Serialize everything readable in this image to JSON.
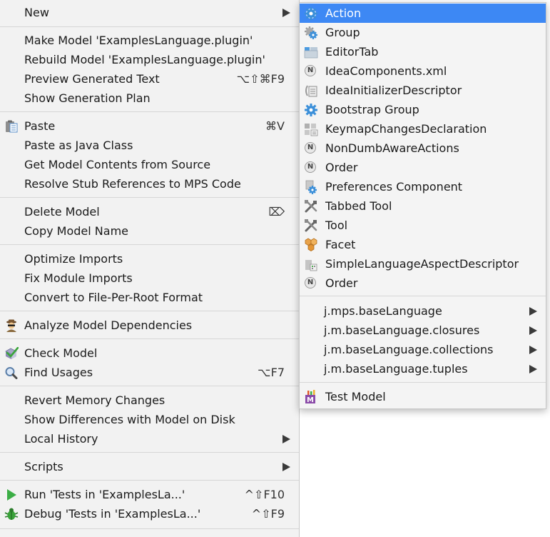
{
  "main_menu": {
    "new": {
      "label": "New"
    },
    "make_model": {
      "label": "Make Model 'ExamplesLanguage.plugin'"
    },
    "rebuild_model": {
      "label": "Rebuild Model 'ExamplesLanguage.plugin'"
    },
    "preview_text": {
      "label": "Preview Generated Text",
      "shortcut": "⌥⇧⌘F9"
    },
    "show_plan": {
      "label": "Show Generation Plan"
    },
    "paste": {
      "label": "Paste",
      "shortcut": "⌘V"
    },
    "paste_java": {
      "label": "Paste as Java Class"
    },
    "get_contents": {
      "label": "Get Model Contents from Source"
    },
    "resolve_stub": {
      "label": "Resolve Stub References to MPS Code"
    },
    "delete_model": {
      "label": "Delete Model",
      "shortcut": "⌦"
    },
    "copy_name": {
      "label": "Copy Model Name"
    },
    "optimize_imports": {
      "label": "Optimize Imports"
    },
    "fix_module_imports": {
      "label": "Fix Module Imports"
    },
    "convert_format": {
      "label": "Convert to File-Per-Root Format"
    },
    "analyze_deps": {
      "label": "Analyze Model Dependencies"
    },
    "check_model": {
      "label": "Check Model"
    },
    "find_usages": {
      "label": "Find Usages",
      "shortcut": "⌥F7"
    },
    "revert_memory": {
      "label": "Revert Memory Changes"
    },
    "show_diff": {
      "label": "Show Differences with Model on Disk"
    },
    "local_history": {
      "label": "Local History"
    },
    "scripts": {
      "label": "Scripts"
    },
    "run_tests": {
      "label": "Run 'Tests in 'ExamplesLa...'",
      "shortcut": "^⇧F10"
    },
    "debug_tests": {
      "label": "Debug 'Tests in 'ExamplesLa...'",
      "shortcut": "^⇧F9"
    }
  },
  "sub_menu": {
    "action": {
      "label": "Action"
    },
    "group": {
      "label": "Group"
    },
    "editor_tab": {
      "label": "EditorTab"
    },
    "idea_components": {
      "label": "IdeaComponents.xml"
    },
    "idea_initializer": {
      "label": "IdeaInitializerDescriptor"
    },
    "bootstrap_group": {
      "label": "Bootstrap Group"
    },
    "keymap_changes": {
      "label": "KeymapChangesDeclaration"
    },
    "non_dumb_aware": {
      "label": "NonDumbAwareActions"
    },
    "order_1": {
      "label": "Order"
    },
    "preferences_component": {
      "label": "Preferences Component"
    },
    "tabbed_tool": {
      "label": "Tabbed Tool"
    },
    "tool": {
      "label": "Tool"
    },
    "facet": {
      "label": "Facet"
    },
    "simple_language_aspect": {
      "label": "SimpleLanguageAspectDescriptor"
    },
    "order_2": {
      "label": "Order"
    },
    "jmps_base": {
      "label": "j.mps.baseLanguage"
    },
    "jm_closures": {
      "label": "j.m.baseLanguage.closures"
    },
    "jm_collections": {
      "label": "j.m.baseLanguage.collections"
    },
    "jm_tuples": {
      "label": "j.m.baseLanguage.tuples"
    },
    "test_model": {
      "label": "Test Model"
    }
  },
  "icon_letters": {
    "n_icon": "N",
    "m_icon": "M"
  },
  "colors": {
    "selection": "#3d88f4",
    "menu_bg": "#f2f2f2",
    "gear": "#3b8fd9"
  }
}
